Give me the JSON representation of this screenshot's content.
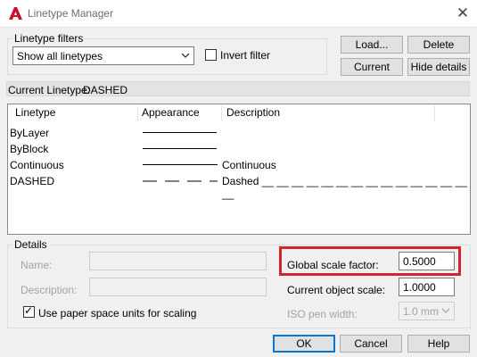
{
  "window": {
    "title": "Linetype Manager",
    "close_glyph": "✕"
  },
  "filters": {
    "group_label": "Linetype filters",
    "selected": "Show all linetypes",
    "invert_label": "Invert filter",
    "invert_checked": false
  },
  "buttons": {
    "load": "Load...",
    "delete": "Delete",
    "current": "Current",
    "hide_details": "Hide details",
    "ok": "OK",
    "cancel": "Cancel",
    "help": "Help"
  },
  "current_linetype": {
    "label": "Current Linetype:",
    "value": "DASHED"
  },
  "list": {
    "columns": [
      "Linetype",
      "Appearance",
      "Description"
    ],
    "rows": [
      {
        "name": "ByLayer",
        "description": ""
      },
      {
        "name": "ByBlock",
        "description": ""
      },
      {
        "name": "Continuous",
        "description": "Continuous"
      },
      {
        "name": "DASHED",
        "description": "Dashed __ __ __ __ __ __ __ __ __ __ __ __ __ __ __"
      }
    ]
  },
  "details": {
    "group_label": "Details",
    "name_label": "Name:",
    "name_value": "",
    "description_label": "Description:",
    "description_value": "",
    "paper_space_label": "Use paper space units for scaling",
    "paper_space_checked": true,
    "global_scale_label": "Global scale factor:",
    "global_scale_value": "0.5000",
    "object_scale_label": "Current object scale:",
    "object_scale_value": "1.0000",
    "iso_pen_label": "ISO pen width:",
    "iso_pen_value": "1.0 mm"
  },
  "colors": {
    "highlight": "#d3262a",
    "app_icon": "#c8102e",
    "focus_border": "#0078d7"
  },
  "icons": {
    "app": "autocad-a-icon",
    "close": "close-icon",
    "dropdown": "chevron-down-icon"
  }
}
